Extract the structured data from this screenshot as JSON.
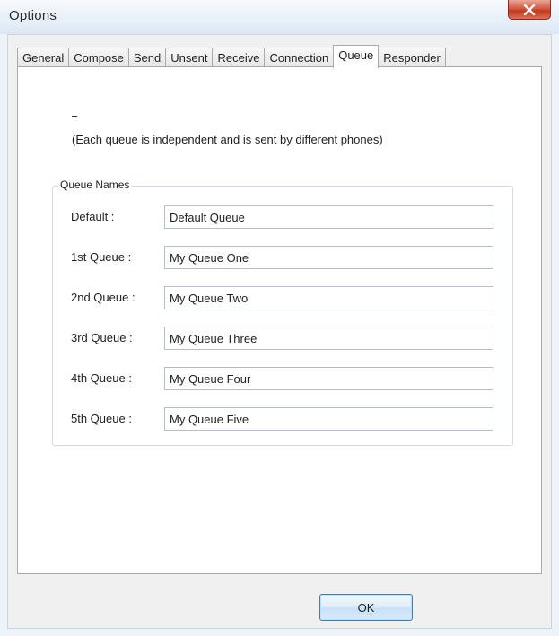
{
  "window": {
    "title": "Options"
  },
  "tabs": [
    {
      "label": "General"
    },
    {
      "label": "Compose"
    },
    {
      "label": "Send"
    },
    {
      "label": "Unsent"
    },
    {
      "label": "Receive"
    },
    {
      "label": "Connection"
    },
    {
      "label": "Queue",
      "active": true
    },
    {
      "label": "Responder"
    }
  ],
  "queue_page": {
    "dash": "–",
    "description": "(Each queue is independent and is sent by different phones)",
    "group_title": "Queue Names",
    "rows": [
      {
        "label": "Default :",
        "value": "Default Queue"
      },
      {
        "label": "1st Queue :",
        "value": "My Queue One"
      },
      {
        "label": "2nd Queue :",
        "value": "My Queue Two"
      },
      {
        "label": "3rd Queue :",
        "value": "My Queue Three"
      },
      {
        "label": "4th Queue :",
        "value": "My Queue Four"
      },
      {
        "label": "5th Queue :",
        "value": "My Queue Five"
      }
    ]
  },
  "footer": {
    "ok_label": "OK"
  },
  "icons": {
    "close": "close-icon"
  },
  "colors": {
    "close_button": "#c2391f",
    "ok_border": "#3c7fb1"
  }
}
